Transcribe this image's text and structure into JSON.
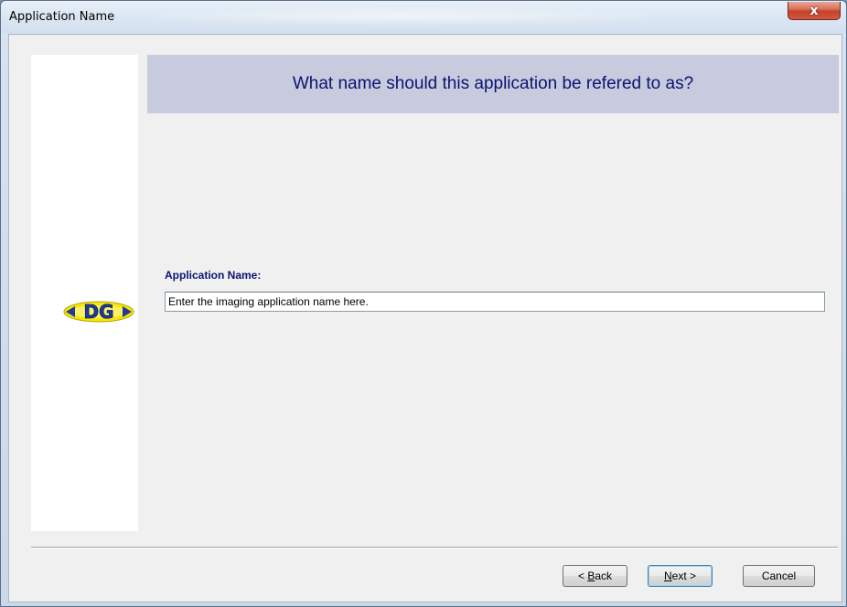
{
  "window": {
    "title": "Application Name",
    "close_glyph": "x"
  },
  "header": {
    "question": "What name should this application be refered to as?"
  },
  "logo": {
    "text": "DG"
  },
  "form": {
    "label": "Application Name:",
    "value": "Enter the imaging application name here."
  },
  "buttons": {
    "back": {
      "prefix": "< ",
      "mnemonic": "B",
      "rest": "ack"
    },
    "next": {
      "mnemonic": "N",
      "rest": "ext >"
    },
    "cancel": "Cancel"
  },
  "colors": {
    "header_band": "#c8cade",
    "header_text": "#0a1470",
    "logo_yellow": "#f4e60a",
    "logo_blue": "#1f3a9a"
  }
}
